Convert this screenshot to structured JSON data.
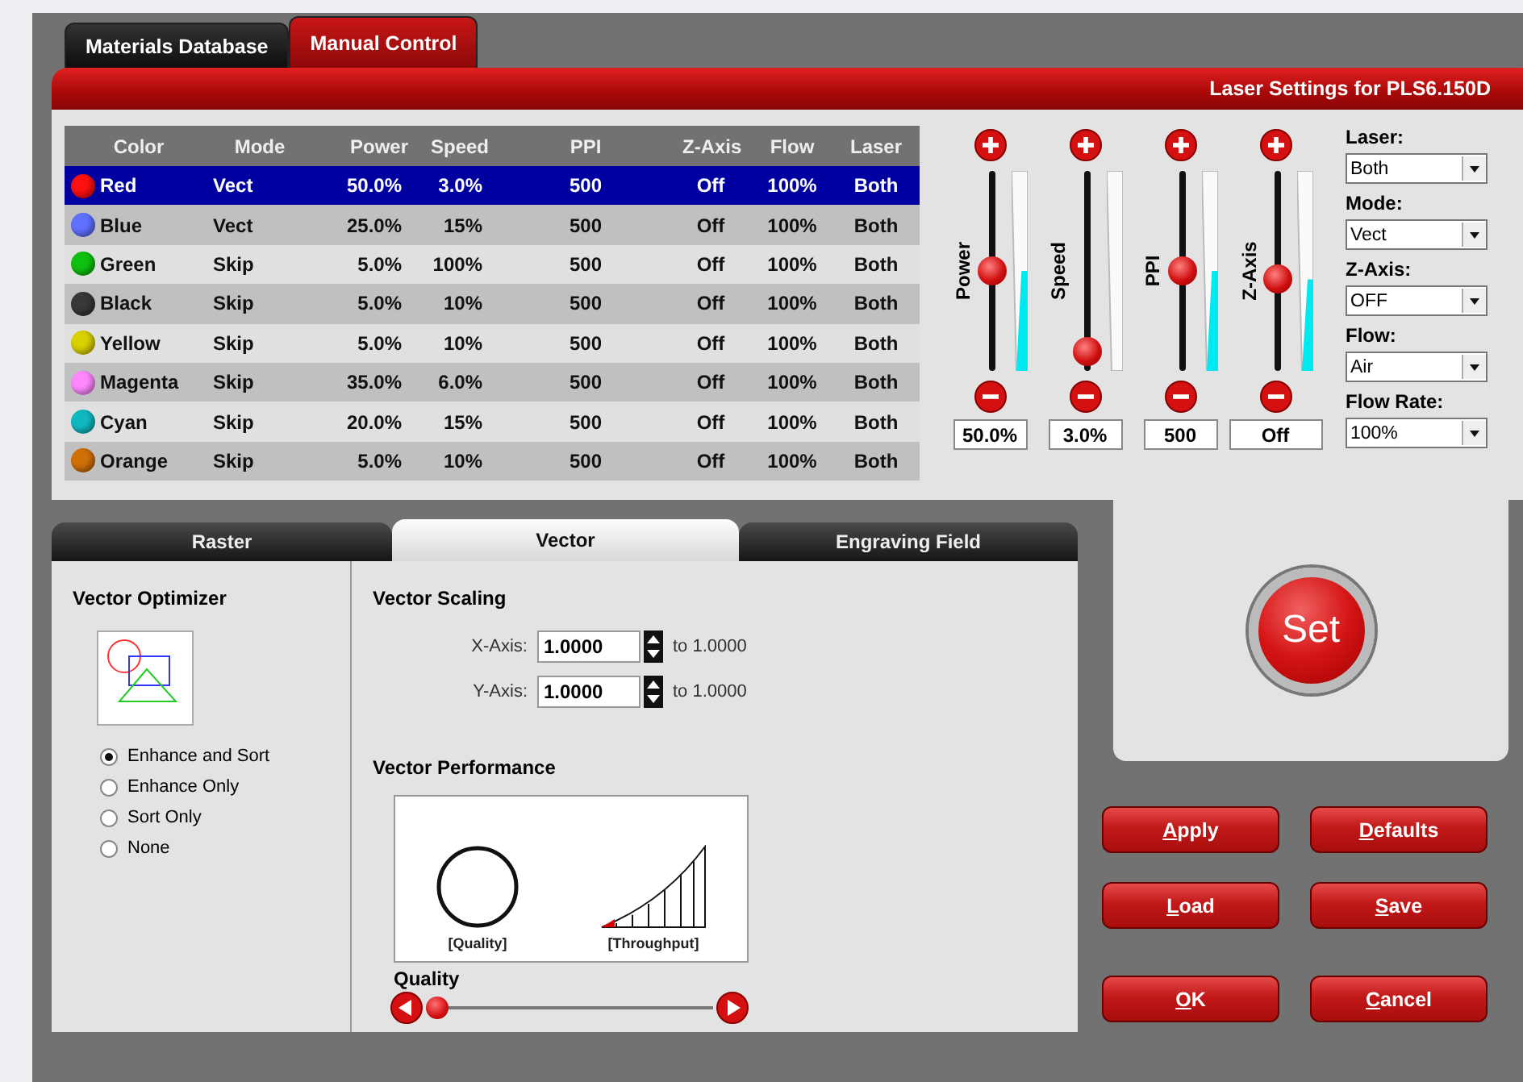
{
  "tabs": [
    {
      "label": "Materials Database",
      "selected": false
    },
    {
      "label": "Manual Control",
      "selected": true
    }
  ],
  "laser_settings": {
    "title": "Laser Settings for PLS6.150D",
    "table": {
      "columns": [
        "Color",
        "Mode",
        "Power",
        "Speed",
        "PPI",
        "Z-Axis",
        "Flow",
        "Laser"
      ],
      "rows": [
        {
          "color": "#ff1010",
          "selected": true,
          "cells": [
            "Red",
            "Vect",
            "50.0%",
            "3.0%",
            "500",
            "Off",
            "100%",
            "Both"
          ]
        },
        {
          "color": "#6070ff",
          "selected": false,
          "cells": [
            "Blue",
            "Vect",
            "25.0%",
            "15%",
            "500",
            "Off",
            "100%",
            "Both"
          ]
        },
        {
          "color": "#10c010",
          "selected": false,
          "cells": [
            "Green",
            "Skip",
            "5.0%",
            "100%",
            "500",
            "Off",
            "100%",
            "Both"
          ]
        },
        {
          "color": "#383838",
          "selected": false,
          "cells": [
            "Black",
            "Skip",
            "5.0%",
            "10%",
            "500",
            "Off",
            "100%",
            "Both"
          ]
        },
        {
          "color": "#d8d000",
          "selected": false,
          "cells": [
            "Yellow",
            "Skip",
            "5.0%",
            "10%",
            "500",
            "Off",
            "100%",
            "Both"
          ]
        },
        {
          "color": "#ff88ff",
          "selected": false,
          "cells": [
            "Magenta",
            "Skip",
            "35.0%",
            "6.0%",
            "500",
            "Off",
            "100%",
            "Both"
          ]
        },
        {
          "color": "#10b8c0",
          "selected": false,
          "cells": [
            "Cyan",
            "Skip",
            "20.0%",
            "15%",
            "500",
            "Off",
            "100%",
            "Both"
          ]
        },
        {
          "color": "#d07008",
          "selected": false,
          "cells": [
            "Orange",
            "Skip",
            "5.0%",
            "10%",
            "500",
            "Off",
            "100%",
            "Both"
          ]
        }
      ]
    },
    "sliders": [
      {
        "label": "Power",
        "level": 0.5,
        "value": "50.0%"
      },
      {
        "label": "Speed",
        "level": 0.03,
        "value": "3.0%"
      },
      {
        "label": "PPI",
        "level": 0.5,
        "value": "500"
      },
      {
        "label": "Z-Axis",
        "level": 0.45,
        "value": "Off"
      }
    ],
    "dropdowns": [
      {
        "label": "Laser:",
        "value": "Both"
      },
      {
        "label": "Mode:",
        "value": "Vect"
      },
      {
        "label": "Z-Axis:",
        "value": "OFF"
      },
      {
        "label": "Flow:",
        "value": "Air"
      },
      {
        "label": "Flow Rate:",
        "value": "100%"
      }
    ]
  },
  "settings_tabs": [
    {
      "label": "Raster",
      "selected": false
    },
    {
      "label": "Vector",
      "selected": true
    },
    {
      "label": "Engraving Field",
      "selected": false
    }
  ],
  "vector_optimizer": {
    "title": "Vector Optimizer",
    "options": [
      {
        "label": "Enhance and Sort",
        "selected": true
      },
      {
        "label": "Enhance Only",
        "selected": false
      },
      {
        "label": "Sort Only",
        "selected": false
      },
      {
        "label": "None",
        "selected": false
      }
    ]
  },
  "vector_scaling": {
    "title": "Vector Scaling",
    "fields": [
      {
        "label": "X-Axis:",
        "value": "1.0000",
        "range": "to 1.0000"
      },
      {
        "label": "Y-Axis:",
        "value": "1.0000",
        "range": "to 1.0000"
      }
    ]
  },
  "vector_performance": {
    "title": "Vector Performance",
    "captions": [
      "[Quality]",
      "[Throughput]"
    ],
    "slider": {
      "label": "Quality",
      "level": 0
    }
  },
  "set_button": "Set",
  "buttons": [
    "Apply",
    "Defaults",
    "Load",
    "Save",
    "OK",
    "Cancel"
  ]
}
